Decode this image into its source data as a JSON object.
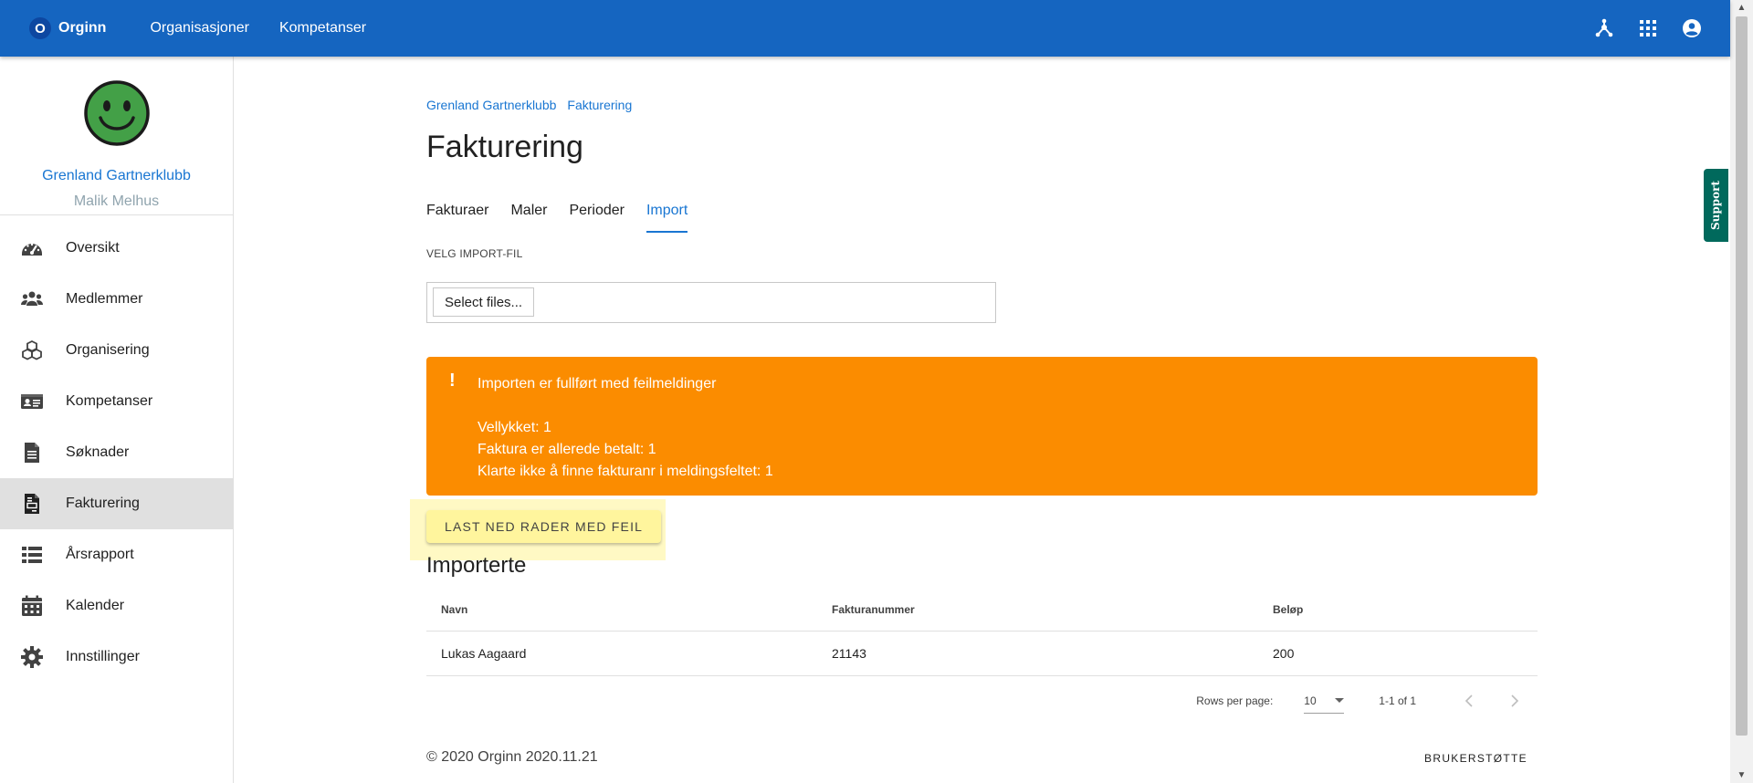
{
  "topbar": {
    "logo_letter": "O",
    "logo_text": "Orginn",
    "nav": [
      "Organisasjoner",
      "Kompetanser"
    ],
    "icons": [
      "hub-icon",
      "apps-grid-icon",
      "account-circle-icon"
    ]
  },
  "sidebar": {
    "club_name": "Grenland Gartnerklubb",
    "user_name": "Malik Melhus",
    "items": [
      {
        "label": "Oversikt",
        "icon": "dashboard-gauge-icon"
      },
      {
        "label": "Medlemmer",
        "icon": "users-icon"
      },
      {
        "label": "Organisering",
        "icon": "cubes-icon"
      },
      {
        "label": "Kompetanser",
        "icon": "id-card-icon"
      },
      {
        "label": "Søknader",
        "icon": "document-icon"
      },
      {
        "label": "Fakturering",
        "icon": "invoice-icon",
        "active": true
      },
      {
        "label": "Årsrapport",
        "icon": "list-icon"
      },
      {
        "label": "Kalender",
        "icon": "calendar-icon"
      },
      {
        "label": "Innstillinger",
        "icon": "gear-icon"
      }
    ]
  },
  "main": {
    "breadcrumb": [
      "Grenland Gartnerklubb",
      "Fakturering"
    ],
    "title": "Fakturering",
    "tabs": [
      {
        "label": "Fakturaer"
      },
      {
        "label": "Maler"
      },
      {
        "label": "Perioder"
      },
      {
        "label": "Import",
        "active": true
      }
    ],
    "file_label": "VELG IMPORT-FIL",
    "file_button": "Select files...",
    "alert": {
      "icon": "!",
      "title": "Importen er fullført med feilmeldinger",
      "lines": [
        "Vellykket: 1",
        "Faktura er allerede betalt: 1",
        "Klarte ikke å finne fakturanr i meldingsfeltet: 1"
      ]
    },
    "download_button": "Last ned rader med feil",
    "imported_title": "Importerte",
    "table": {
      "headers": [
        "Navn",
        "Fakturanummer",
        "Beløp"
      ],
      "rows": [
        [
          "Lukas Aagaard",
          "21143",
          "200"
        ]
      ]
    },
    "pager": {
      "rows_label": "Rows per page:",
      "rows_value": "10",
      "range": "1-1 of 1"
    },
    "footer_copy": "© 2020 Orginn 2020.11.21",
    "footer_link": "BRUKERSTØTTE"
  },
  "support_label": "Support",
  "colors": {
    "primary": "#1565c0",
    "link": "#1976d2",
    "alert": "#fb8c00",
    "support": "#00695c",
    "highlight": "#fff59d"
  }
}
